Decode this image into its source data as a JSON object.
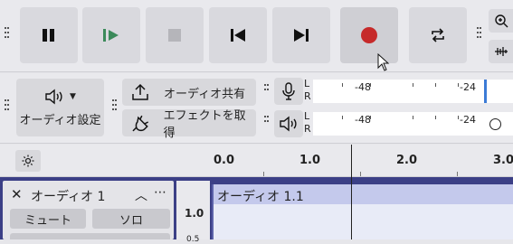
{
  "transport": {
    "pause_icon": "pause-icon",
    "play_icon": "play-icon",
    "stop_icon": "stop-icon",
    "skip_start_icon": "skip-to-start-icon",
    "skip_end_icon": "skip-to-end-icon",
    "record_icon": "record-icon",
    "loop_icon": "loop-icon",
    "play_color": "#3b8a5a",
    "record_color": "#c62a2a"
  },
  "audio_setup": {
    "label": "オーディオ設定"
  },
  "share_audio": {
    "label": "オーディオ共有"
  },
  "get_effects": {
    "label": "エフェクトを取得"
  },
  "meters": {
    "record": {
      "l": "L",
      "r": "R",
      "ticks": [
        "-48",
        "-24"
      ]
    },
    "playback": {
      "l": "L",
      "r": "R",
      "ticks": [
        "-48",
        "-24"
      ]
    }
  },
  "timeline": {
    "ticks": [
      "0.0",
      "1.0",
      "2.0",
      "3.0"
    ]
  },
  "track": {
    "name": "オーディオ 1",
    "mute": "ミュート",
    "solo": "ソロ",
    "clip_name": "オーディオ 1.1",
    "scale_top": "1.0",
    "scale_next": "0.5"
  }
}
